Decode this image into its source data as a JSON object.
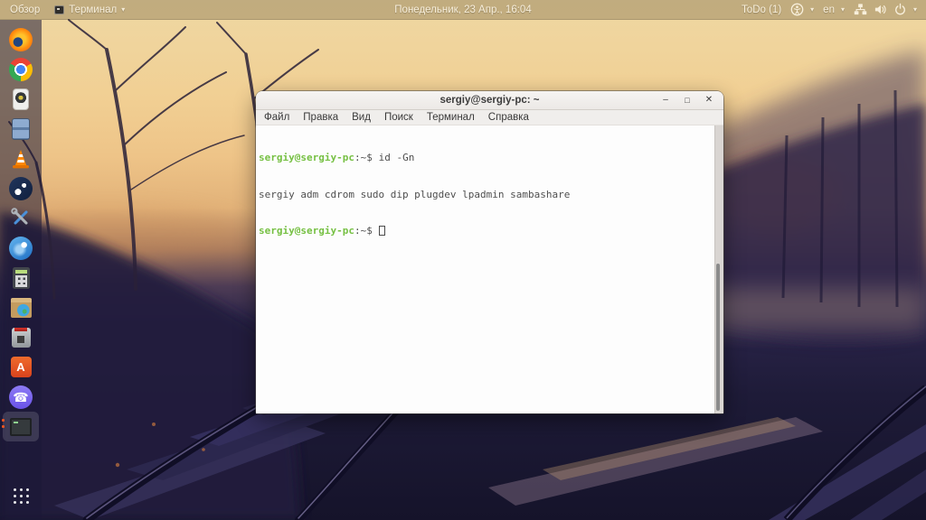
{
  "top_bar": {
    "activities": "Обзор",
    "app_menu_label": "Терминал",
    "caret": "▾",
    "clock": "Понедельник, 23 Апр., 16:04",
    "todo": "ToDo (1)",
    "language": "en",
    "icons": [
      "accessibility-icon",
      "wired-network-icon",
      "volume-icon",
      "power-icon"
    ]
  },
  "dock": {
    "indicator_color": "#e95420",
    "items": [
      {
        "name": "firefox",
        "icon": "firefox-icon"
      },
      {
        "name": "chrome",
        "icon": "chrome-icon"
      },
      {
        "name": "audio-player",
        "icon": "speaker-box-icon"
      },
      {
        "name": "file-cabinet",
        "icon": "file-cabinet-icon"
      },
      {
        "name": "vlc",
        "icon": "vlc-cone-icon"
      },
      {
        "name": "steam",
        "icon": "steam-icon"
      },
      {
        "name": "tweak-tools",
        "icon": "crossed-tools-icon"
      },
      {
        "name": "thunderbird",
        "icon": "thunderbird-icon"
      },
      {
        "name": "calculator",
        "icon": "calculator-icon"
      },
      {
        "name": "package-manager",
        "icon": "box-globe-icon"
      },
      {
        "name": "transmission",
        "icon": "transmission-icon"
      },
      {
        "name": "ubuntu-software",
        "icon": "software-bag-icon",
        "glyph": "A"
      },
      {
        "name": "viber",
        "icon": "viber-phone-icon",
        "glyph": "☎"
      },
      {
        "name": "terminal",
        "icon": "terminal-icon",
        "running": true
      },
      {
        "name": "show-applications",
        "icon": "dots-grid-icon"
      }
    ]
  },
  "window": {
    "title": "sergiy@sergiy-pc: ~",
    "controls": {
      "minimize": "–",
      "maximize": "□",
      "close": "✕"
    },
    "menu": [
      "Файл",
      "Правка",
      "Вид",
      "Поиск",
      "Терминал",
      "Справка"
    ],
    "terminal": {
      "background": "#fdfdfd",
      "foreground": "#4e4e4e",
      "prompt_color": "#76c043",
      "prompt_user": "sergiy@sergiy-pc",
      "prompt_suffix": ":~$",
      "lines": [
        {
          "command": "id -Gn"
        },
        {
          "output": "sergiy adm cdrom sudo dip plugdev lpadmin sambashare"
        },
        {
          "command": ""
        }
      ]
    }
  }
}
